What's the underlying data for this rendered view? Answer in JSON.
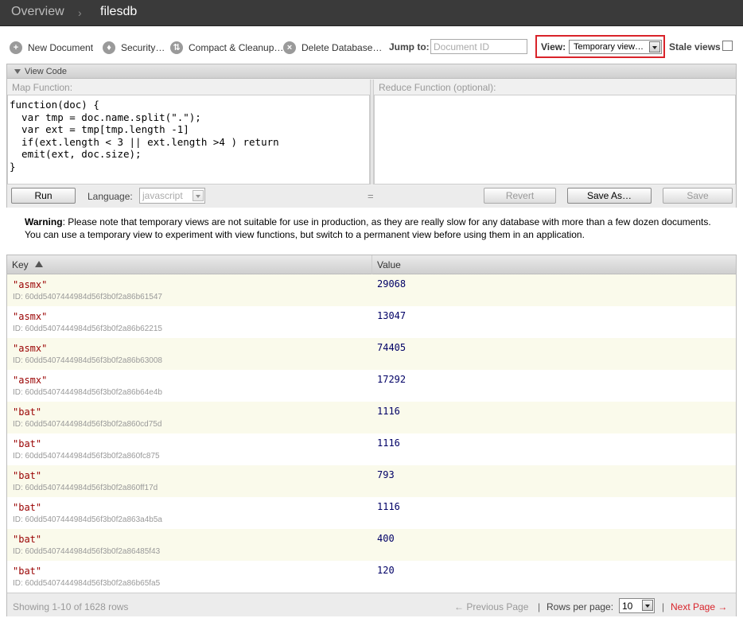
{
  "breadcrumb": {
    "overview": "Overview",
    "separator": "›",
    "database": "filesdb"
  },
  "toolbar": {
    "new_document": {
      "label": "New Document",
      "icon": "+"
    },
    "security": {
      "label": "Security…",
      "icon": "♦"
    },
    "compact": {
      "label": "Compact & Cleanup…",
      "icon": "⇅"
    },
    "delete_db": {
      "label": "Delete Database…",
      "icon": "×"
    },
    "jump_label": "Jump to:",
    "jump_placeholder": "Document ID",
    "view_label": "View:",
    "view_selected": "Temporary view…",
    "stale_label": "Stale views"
  },
  "code_panel": {
    "header": "View Code",
    "map_label": "Map Function:",
    "reduce_label": "Reduce Function (optional):",
    "map_code": "function(doc) {\n  var tmp = doc.name.split(\".\");\n  var ext = tmp[tmp.length -1]\n  if(ext.length < 3 || ext.length >4 ) return\n  emit(ext, doc.size);\n}",
    "reduce_code": "",
    "run_label": "Run",
    "language_label": "Language:",
    "language_value": "javascript",
    "resize_handle": "=",
    "revert_label": "Revert",
    "save_as_label": "Save As…",
    "save_label": "Save"
  },
  "warning": {
    "title": "Warning",
    "text": ": Please note that temporary views are not suitable for use in production, as they are really slow for any database with more than a few dozen documents. You can use a temporary view to experiment with view functions, but switch to a permanent view before using them in an application."
  },
  "results": {
    "key_header": "Key",
    "value_header": "Value",
    "rows": [
      {
        "key": "\"asmx\"",
        "id": "ID: 60dd5407444984d56f3b0f2a86b61547",
        "value": "29068"
      },
      {
        "key": "\"asmx\"",
        "id": "ID: 60dd5407444984d56f3b0f2a86b62215",
        "value": "13047"
      },
      {
        "key": "\"asmx\"",
        "id": "ID: 60dd5407444984d56f3b0f2a86b63008",
        "value": "74405"
      },
      {
        "key": "\"asmx\"",
        "id": "ID: 60dd5407444984d56f3b0f2a86b64e4b",
        "value": "17292"
      },
      {
        "key": "\"bat\"",
        "id": "ID: 60dd5407444984d56f3b0f2a860cd75d",
        "value": "1116"
      },
      {
        "key": "\"bat\"",
        "id": "ID: 60dd5407444984d56f3b0f2a860fc875",
        "value": "1116"
      },
      {
        "key": "\"bat\"",
        "id": "ID: 60dd5407444984d56f3b0f2a860ff17d",
        "value": "793"
      },
      {
        "key": "\"bat\"",
        "id": "ID: 60dd5407444984d56f3b0f2a863a4b5a",
        "value": "1116"
      },
      {
        "key": "\"bat\"",
        "id": "ID: 60dd5407444984d56f3b0f2a86485f43",
        "value": "400"
      },
      {
        "key": "\"bat\"",
        "id": "ID: 60dd5407444984d56f3b0f2a86b65fa5",
        "value": "120"
      }
    ],
    "footer": {
      "count": "Showing 1-10 of 1628 rows",
      "prev": "← Previous Page",
      "pipe": "|",
      "rows_per_page_label": "Rows per page:",
      "rows_per_page_value": "10",
      "next": "Next Page →"
    }
  },
  "colors": {
    "accent_red": "#d9232a",
    "key_color": "#990000",
    "value_color": "#000066",
    "topbar": "#3a3a3a"
  }
}
